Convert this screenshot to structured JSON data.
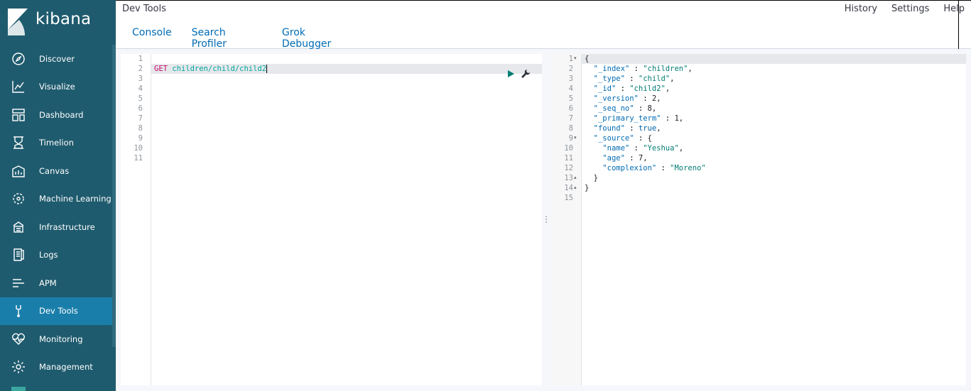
{
  "app": {
    "logo_text": "kibana"
  },
  "sidebar": {
    "items": [
      {
        "label": "Discover",
        "icon": "compass-icon"
      },
      {
        "label": "Visualize",
        "icon": "chart-icon"
      },
      {
        "label": "Dashboard",
        "icon": "dashboard-icon"
      },
      {
        "label": "Timelion",
        "icon": "timelion-icon"
      },
      {
        "label": "Canvas",
        "icon": "canvas-icon"
      },
      {
        "label": "Machine Learning",
        "icon": "ml-icon"
      },
      {
        "label": "Infrastructure",
        "icon": "infrastructure-icon"
      },
      {
        "label": "Logs",
        "icon": "logs-icon"
      },
      {
        "label": "APM",
        "icon": "apm-icon"
      },
      {
        "label": "Dev Tools",
        "icon": "wrench-icon",
        "active": true
      },
      {
        "label": "Monitoring",
        "icon": "heartbeat-icon"
      },
      {
        "label": "Management",
        "icon": "gear-icon"
      }
    ]
  },
  "header": {
    "title": "Dev Tools",
    "links": {
      "history": "History",
      "settings": "Settings",
      "help": "Help"
    },
    "tabs": [
      {
        "label": "Console",
        "active": true
      },
      {
        "label": "Search Profiler"
      },
      {
        "label": "Grok Debugger"
      }
    ]
  },
  "request": {
    "line_numbers": [
      "1",
      "2",
      "3",
      "4",
      "5",
      "6",
      "7",
      "8",
      "9",
      "10",
      "11"
    ],
    "method": "GET",
    "url": "children/child/child2"
  },
  "response": {
    "line_numbers": [
      "1",
      "2",
      "3",
      "4",
      "5",
      "6",
      "7",
      "8",
      "9",
      "10",
      "11",
      "12",
      "13",
      "14",
      "15"
    ],
    "lines": [
      "{",
      "  \"_index\" : \"children\",",
      "  \"_type\" : \"child\",",
      "  \"_id\" : \"child2\",",
      "  \"_version\" : 2,",
      "  \"_seq_no\" : 8,",
      "  \"_primary_term\" : 1,",
      "  \"found\" : true,",
      "  \"_source\" : {",
      "    \"name\" : \"Yeshua\",",
      "    \"age\" : 7,",
      "    \"complexion\" : \"Moreno\"",
      "  }",
      "}",
      ""
    ],
    "folds": {
      "1": "down",
      "9": "down",
      "13": "up",
      "14": "up"
    }
  },
  "colors": {
    "sidebar_bg": "#1f5b6e",
    "active_nav": "#1a7eaa",
    "link": "#006bb4",
    "method": "#c80a68",
    "url": "#00a69b"
  }
}
